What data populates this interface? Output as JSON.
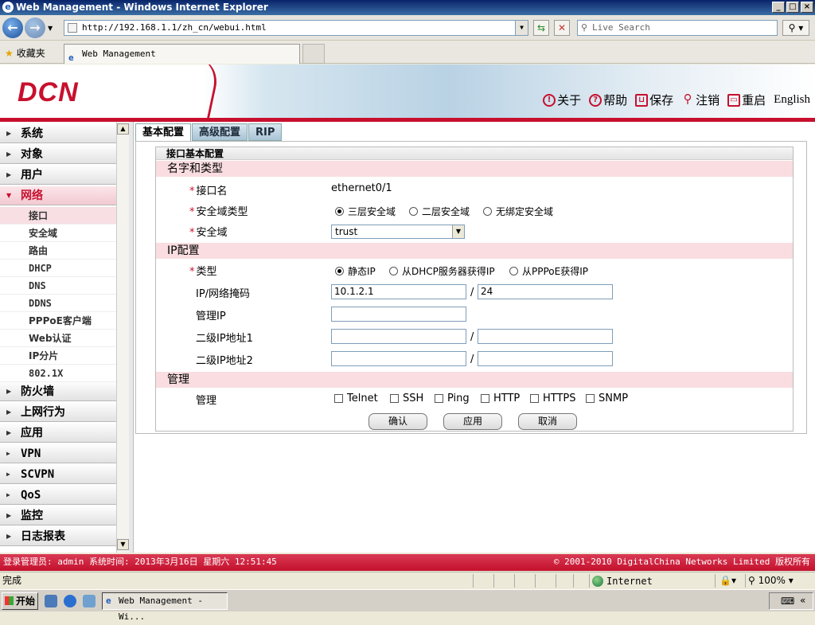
{
  "window": {
    "title": "Web Management - Windows Internet Explorer",
    "controls": [
      "_",
      "□",
      "×"
    ]
  },
  "browser": {
    "url": "http://192.168.1.1/zh_cn/webui.html",
    "search_placeholder": "Live Search",
    "favorites_label": "收藏夹",
    "tab_title": "Web Management",
    "status_left": "完成",
    "zone": "Internet",
    "zoom": "100%"
  },
  "header": {
    "logo": "DCN",
    "nav": [
      {
        "label": "关于",
        "icon": "info-icon",
        "glyph": "!"
      },
      {
        "label": "帮助",
        "icon": "help-icon",
        "glyph": "?"
      },
      {
        "label": "保存",
        "icon": "save-icon",
        "glyph": "⊔"
      },
      {
        "label": "注销",
        "icon": "key-icon",
        "glyph": "⚲"
      },
      {
        "label": "重启",
        "icon": "restart-icon",
        "glyph": "▭"
      },
      {
        "label": "English"
      }
    ],
    "accent": "#c8102e"
  },
  "sidebar": {
    "items": [
      {
        "label": "系统"
      },
      {
        "label": "对象"
      },
      {
        "label": "用户"
      },
      {
        "label": "网络",
        "expanded": true
      },
      {
        "label": "防火墙"
      },
      {
        "label": "上网行为"
      },
      {
        "label": "应用"
      },
      {
        "label": "VPN"
      },
      {
        "label": "SCVPN"
      },
      {
        "label": "QoS"
      },
      {
        "label": "监控"
      },
      {
        "label": "日志报表"
      }
    ],
    "network_subitems": [
      "接口",
      "安全域",
      "路由",
      "DHCP",
      "DNS",
      "DDNS",
      "PPPoE客户端",
      "Web认证",
      "IP分片",
      "802.1X"
    ],
    "selected_sub": "接口"
  },
  "tabs": [
    "基本配置",
    "高级配置",
    "RIP"
  ],
  "form": {
    "fieldset_title": "接口基本配置",
    "sections": {
      "name_type": "名字和类型",
      "ip": "IP配置",
      "mgmt": "管理"
    },
    "interface_name_label": "接口名",
    "interface_name": "ethernet0/1",
    "zone_type_label": "安全域类型",
    "zone_type_options": [
      "三层安全域",
      "二层安全域",
      "无绑定安全域"
    ],
    "zone_type_selected": 0,
    "zone_label": "安全域",
    "zone_value": "trust",
    "ip_type_label": "类型",
    "ip_type_options": [
      "静态IP",
      "从DHCP服务器获得IP",
      "从PPPoE获得IP"
    ],
    "ip_type_selected": 0,
    "ip_mask_label": "IP/网络掩码",
    "ip_value": "10.1.2.1",
    "mask_value": "24",
    "mgmt_ip_label": "管理IP",
    "mgmt_ip_value": "",
    "secondary1_label": "二级IP地址1",
    "secondary2_label": "二级IP地址2",
    "mgmt_label": "管理",
    "mgmt_options": [
      "Telnet",
      "SSH",
      "Ping",
      "HTTP",
      "HTTPS",
      "SNMP"
    ],
    "buttons": {
      "ok": "确认",
      "apply": "应用",
      "cancel": "取消"
    },
    "slash": "/"
  },
  "footer": {
    "left": "登录管理员: admin 系统时间: 2013年3月16日 星期六 12:51:45",
    "right": "© 2001-2010 DigitalChina Networks Limited 版权所有"
  },
  "taskbar": {
    "start": "开始",
    "task": "Web Management - Wi..."
  }
}
